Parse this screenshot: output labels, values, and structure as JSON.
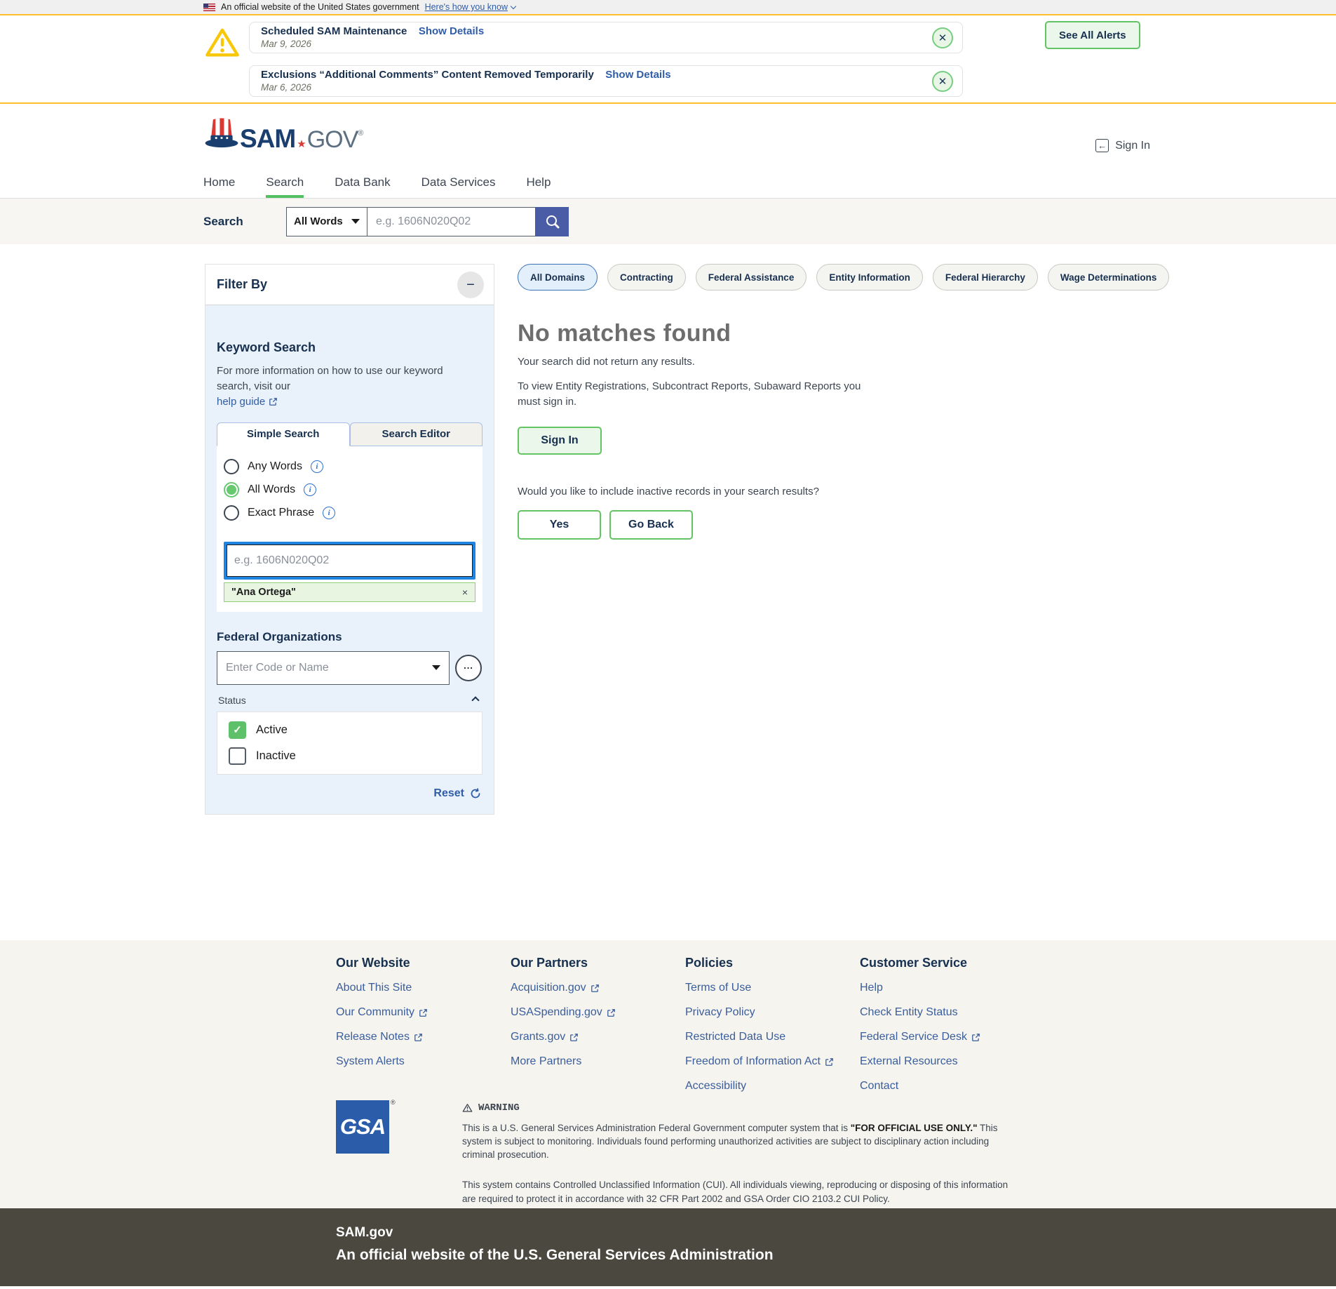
{
  "colors": {
    "accent_gold": "#ffbe2e",
    "accent_green": "#62c462",
    "link_blue": "#2f5da8",
    "button_indigo": "#4a5ca6",
    "navy": "#17304f",
    "panel_blue": "#e9f1fb",
    "footer_dark": "#4a483f",
    "gsa_blue": "#2a5caa"
  },
  "banner": {
    "text": "An official website of the United States government",
    "link": "Here's how you know"
  },
  "alerts": {
    "see_all": "See All Alerts",
    "items": [
      {
        "title": "Scheduled SAM Maintenance",
        "link": "Show Details",
        "date": "Mar 9, 2026"
      },
      {
        "title": "Exclusions “Additional Comments” Content Removed Temporarily",
        "link": "Show Details",
        "date": "Mar 6, 2026"
      }
    ]
  },
  "header": {
    "logo_text": "SAM",
    "logo_star": "★",
    "logo_gov": "GOV",
    "logo_reg": "®",
    "sign_in": "Sign In",
    "signin_arrow": "←"
  },
  "nav": {
    "items": [
      "Home",
      "Search",
      "Data Bank",
      "Data Services",
      "Help"
    ]
  },
  "searchbar": {
    "label": "Search",
    "mode": "All Words",
    "placeholder": "e.g. 1606N020Q02"
  },
  "filter": {
    "title": "Filter By",
    "collapse_icon": "−",
    "keyword_heading": "Keyword Search",
    "keyword_info": "For more information on how to use our keyword search, visit our",
    "help_link": "help guide",
    "tab_simple": "Simple Search",
    "tab_editor": "Search Editor",
    "radio_any": "Any Words",
    "radio_all": "All Words",
    "radio_exact": "Exact Phrase",
    "info_icon": "i",
    "keyword_placeholder": "e.g. 1606N020Q02",
    "chip_label": "\"Ana Ortega\"",
    "chip_remove": "×",
    "orgs_heading": "Federal Organizations",
    "orgs_placeholder": "Enter Code or Name",
    "ellipsis": "...",
    "status_label": "Status",
    "status_active": "Active",
    "status_check": "✓",
    "status_inactive": "Inactive",
    "reset": "Reset"
  },
  "results": {
    "domains": [
      "All Domains",
      "Contracting",
      "Federal Assistance",
      "Entity Information",
      "Federal Hierarchy",
      "Wage Determinations"
    ],
    "title": "No matches found",
    "subtitle": "Your search did not return any results.",
    "signin_note": "To view Entity Registrations, Subcontract Reports, Subaward Reports you must sign in.",
    "sign_in": "Sign In",
    "question": "Would you like to include inactive records in your search results?",
    "yes": "Yes",
    "go_back": "Go Back"
  },
  "footer": {
    "columns": [
      {
        "heading": "Our Website",
        "links": [
          "About This Site",
          "Our Community",
          "Release Notes",
          "System Alerts"
        ]
      },
      {
        "heading": "Our Partners",
        "links": [
          "Acquisition.gov",
          "USASpending.gov",
          "Grants.gov",
          "More Partners"
        ]
      },
      {
        "heading": "Policies",
        "links": [
          "Terms of Use",
          "Privacy Policy",
          "Restricted Data Use",
          "Freedom of Information Act",
          "Accessibility"
        ]
      },
      {
        "heading": "Customer Service",
        "links": [
          "Help",
          "Check Entity Status",
          "Federal Service Desk",
          "External Resources",
          "Contact"
        ]
      }
    ],
    "gsa": "GSA",
    "gsa_reg": "®",
    "warning_title": "WARNING",
    "warning_p1_pre": "This is a U.S. General Services Administration Federal Government computer system that is ",
    "warning_p1_bold": "\"FOR OFFICIAL USE ONLY.\"",
    "warning_p1_post": " This system is subject to monitoring. Individuals found performing unauthorized activities are subject to disciplinary action including criminal prosecution.",
    "warning_p2": "This system contains Controlled Unclassified Information (CUI). All individuals viewing, reproducing or disposing of this information are required to protect it in accordance with 32 CFR Part 2002 and GSA Order CIO 2103.2 CUI Policy.",
    "site_name": "SAM.gov",
    "official_line": "An official website of the U.S. General Services Administration"
  }
}
